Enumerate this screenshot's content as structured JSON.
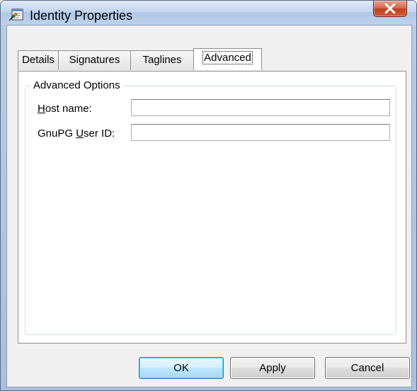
{
  "window": {
    "title": "Identity Properties",
    "icon": "properties-icon",
    "close_icon": "close-x-icon"
  },
  "tabs": [
    {
      "label": "Details",
      "active": false
    },
    {
      "label": "Signatures",
      "active": false
    },
    {
      "label": "Taglines",
      "active": false
    },
    {
      "label": "Advanced",
      "active": true
    }
  ],
  "advanced": {
    "group_title": "Advanced Options",
    "host_name": {
      "label_mnemonic": "H",
      "label_rest": "ost name:",
      "value": ""
    },
    "gnupg": {
      "label_before": "GnuPG ",
      "label_mnemonic": "U",
      "label_rest": "ser ID:",
      "value": ""
    }
  },
  "buttons": {
    "ok": "OK",
    "apply": "Apply",
    "cancel": "Cancel"
  }
}
